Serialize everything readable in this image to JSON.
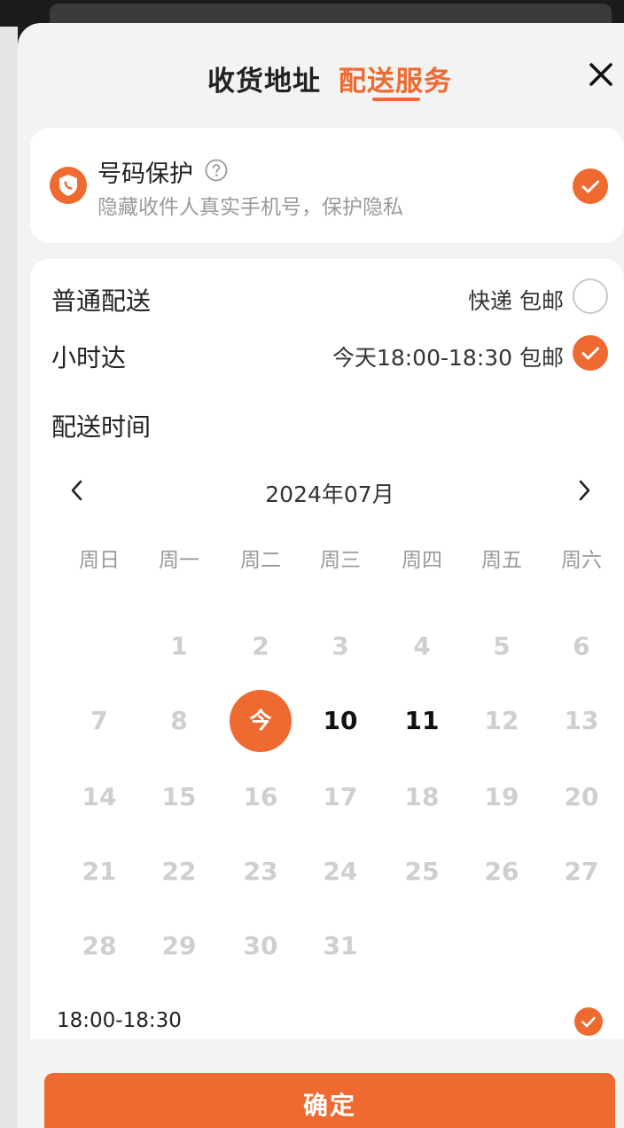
{
  "tabs": {
    "address": "收货地址",
    "delivery": "配送服务"
  },
  "protect": {
    "title": "号码保护",
    "subtitle": "隐藏收件人真实手机号，保护隐私"
  },
  "delivery": {
    "normal_label": "普通配送",
    "normal_value": "快递 包邮",
    "hour_label": "小时达",
    "hour_value": "今天18:00-18:30 包邮",
    "section_title": "配送时间"
  },
  "calendar": {
    "month": "2024年07月",
    "weekdays": [
      "周日",
      "周一",
      "周二",
      "周三",
      "周四",
      "周五",
      "周六"
    ],
    "rows": [
      [
        "",
        "1",
        "2",
        "3",
        "4",
        "5",
        "6"
      ],
      [
        "7",
        "8",
        "今",
        "10",
        "11",
        "12",
        "13"
      ],
      [
        "14",
        "15",
        "16",
        "17",
        "18",
        "19",
        "20"
      ],
      [
        "21",
        "22",
        "23",
        "24",
        "25",
        "26",
        "27"
      ],
      [
        "28",
        "29",
        "30",
        "31",
        "",
        "",
        ""
      ]
    ],
    "today_label": "今",
    "available_days": [
      "10",
      "11"
    ]
  },
  "slot": {
    "label": "18:00-18:30"
  },
  "confirm_label": "确定",
  "colors": {
    "accent": "#ee6a30",
    "disabled": "#cfcfcf"
  },
  "icons": {
    "close": "close-icon",
    "shield": "phone-shield-icon",
    "help": "question-icon",
    "check": "check-icon",
    "prev": "chevron-left-icon",
    "next": "chevron-right-icon"
  }
}
